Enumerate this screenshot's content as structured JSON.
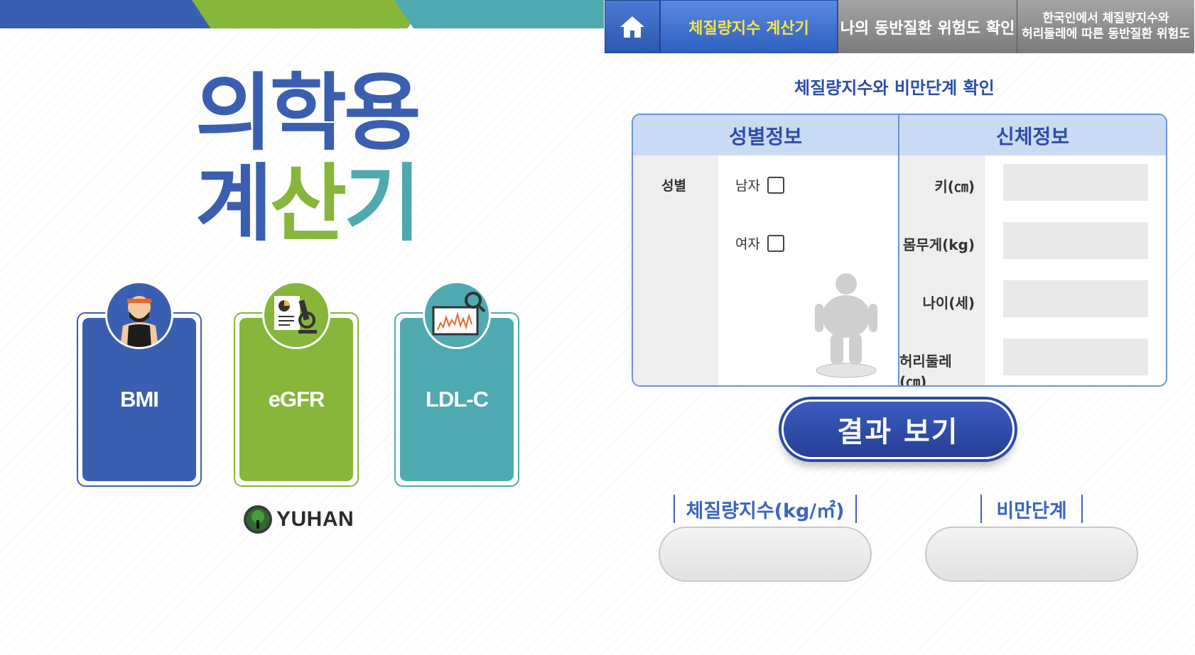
{
  "app": {
    "title_line1": "의학용",
    "title_line2_a": "계",
    "title_line2_b": "산",
    "title_line2_c": "기",
    "brand": "YUHAN",
    "colors": {
      "blue": "#3a5fb0",
      "green": "#86b63a",
      "teal": "#4fa9b0",
      "tab_active_text": "#f8e34a"
    }
  },
  "calculators": [
    {
      "label": "BMI",
      "icon": "person-headband-icon"
    },
    {
      "label": "eGFR",
      "icon": "lab-report-microscope-icon"
    },
    {
      "label": "LDL-C",
      "icon": "monitor-chart-magnifier-icon"
    }
  ],
  "tabs": {
    "home_icon": "home-icon",
    "active": "체질량지수 계산기",
    "tab2": "나의 동반질환 위험도 확인",
    "tab3_line1": "한국인에서 체질량지수와",
    "tab3_line2": "허리둘레에 따른 동반질환 위험도"
  },
  "section_title": "체질량지수와 비만단계 확인",
  "form": {
    "gender_header": "성별정보",
    "body_header": "신체정보",
    "gender_label": "성별",
    "male": "남자",
    "female": "여자",
    "height_label": "키(㎝)",
    "weight_label": "몸무게(kg)",
    "age_label": "나이(세)",
    "waist_label": "허리둘레(㎝)"
  },
  "result_button": "결과 보기",
  "results": {
    "bmi_label": "체질량지수(kg/㎡)",
    "grade_label": "비만단계"
  }
}
